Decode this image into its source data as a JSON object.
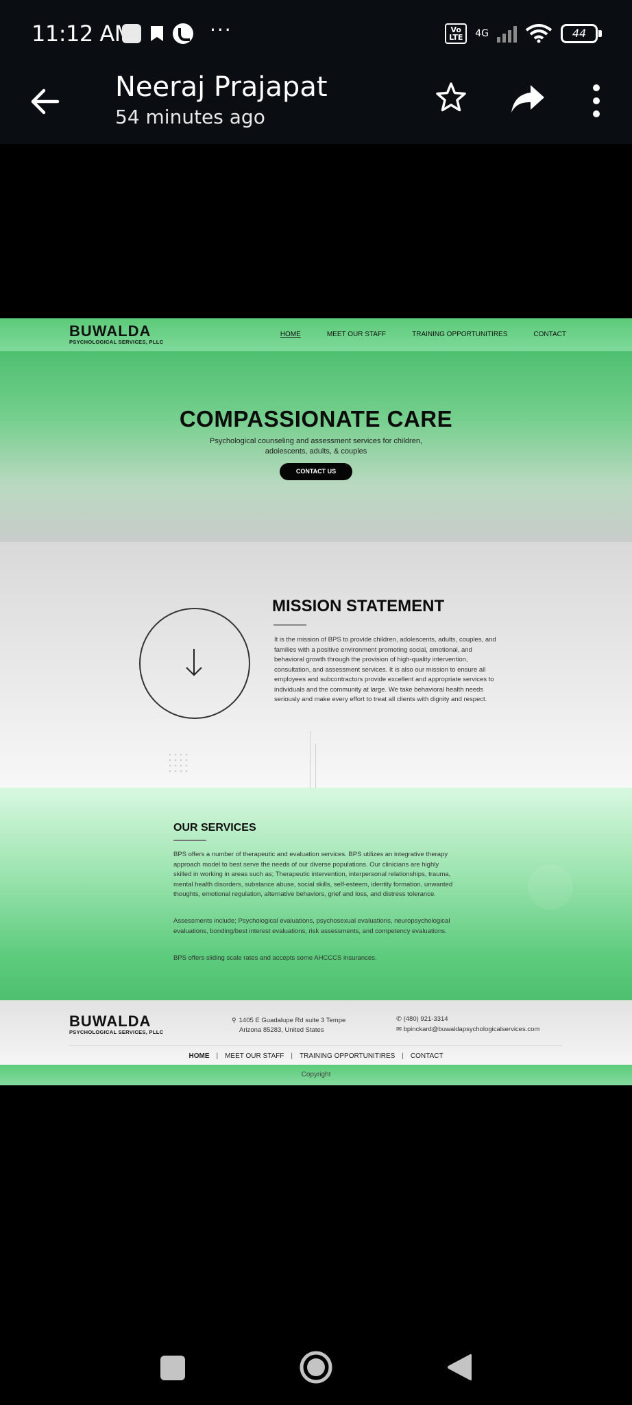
{
  "status_bar": {
    "time": "11:12 AM",
    "network": "4G",
    "volte": "Vo LTE",
    "battery": "44"
  },
  "app_bar": {
    "title": "Neeraj Prajapat",
    "subtitle": "54 minutes ago"
  },
  "website": {
    "logo": {
      "name": "BUWALDA",
      "tagline": "PSYCHOLOGICAL SERVICES, PLLC"
    },
    "nav": [
      {
        "label": "HOME",
        "active": true
      },
      {
        "label": "MEET OUR STAFF",
        "active": false
      },
      {
        "label": "TRAINING OPPORTUNITIRES",
        "active": false
      },
      {
        "label": "CONTACT",
        "active": false
      }
    ],
    "hero": {
      "title": "COMPASSIONATE CARE",
      "description": "Psychological counseling and assessment services for children, adolescents, adults, & couples",
      "button": "CONTACT US"
    },
    "mission": {
      "title": "MISSION STATEMENT",
      "text": "It is the mission of BPS to provide children, adolescents, adults, couples, and families with a positive environment promoting social, emotional, and behavioral growth through the provision of high-quality intervention, consultation, and assessment services. It is also our mission to ensure all employees and subcontractors provide excellent and appropriate services to individuals and the community at large. We take behavioral health needs seriously and make every effort to treat all clients with dignity and respect."
    },
    "services": {
      "title": "OUR SERVICES",
      "paragraph1": "BPS offers a number of therapeutic and evaluation services. BPS utilizes an integrative therapy approach model to best serve the needs of our diverse populations. Our clinicians are highly skilled in working in areas such as; Therapeutic intervention, interpersonal relationships, trauma, mental health disorders, substance abuse, social skills, self-esteem, identity formation, unwanted thoughts, emotional regulation, alternative behaviors, grief and loss, and distress tolerance.",
      "paragraph2": "Assessments include; Psychological evaluations, psychosexual evaluations, neuropsychological evaluations, bonding/best interest evaluations, risk assessments, and competency evaluations.",
      "paragraph3": "BPS offers sliding scale rates and accepts some AHCCCS insurances."
    },
    "footer": {
      "address_line1": "1405 E Guadalupe Rd suite 3 Tempe",
      "address_line2": "Arizona 85283, United States",
      "phone": "(480) 921-3314",
      "email": "bpinckard@buwaldapsychologicalservices.com",
      "links": [
        "HOME",
        "MEET OUR STAFF",
        "TRAINING OPPORTUNITIRES",
        "CONTACT"
      ],
      "copyright": "Copyright"
    }
  }
}
